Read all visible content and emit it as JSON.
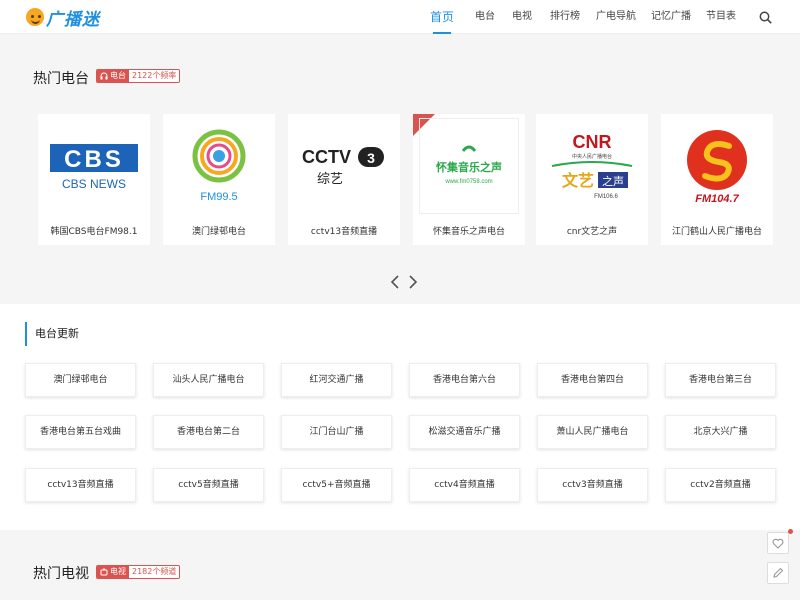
{
  "header": {
    "logo_text": "广播迷",
    "nav": [
      "首页",
      "电台",
      "电视",
      "排行榜",
      "广电导航",
      "记忆广播",
      "节目表"
    ],
    "active_nav": "首页"
  },
  "hot_radio": {
    "title": "热门电台",
    "tag_label": "电台",
    "tag_count": "2122个频率",
    "cards": [
      {
        "label": "韩国CBS电台FM98.1",
        "logo": "CBS NEWS"
      },
      {
        "label": "澳门绿邨电台",
        "logo": "FM99.5"
      },
      {
        "label": "cctv13音频直播",
        "logo": "CCTV 3 综艺"
      },
      {
        "label": "怀集音乐之声电台",
        "logo": "怀集音乐之声"
      },
      {
        "label": "cnr文艺之声",
        "logo": "CNR 文艺之声 FM106.6"
      },
      {
        "label": "江门鹤山人民广播电台",
        "logo": "FM104.7"
      }
    ]
  },
  "updates": {
    "title": "电台更新",
    "items": [
      "澳门绿邨电台",
      "汕头人民广播电台",
      "红河交通广播",
      "香港电台第六台",
      "香港电台第四台",
      "香港电台第三台",
      "香港电台第五台戏曲",
      "香港电台第二台",
      "江门台山广播",
      "松滋交通音乐广播",
      "萧山人民广播电台",
      "北京大兴广播",
      "cctv13音频直播",
      "cctv5音频直播",
      "cctv5+音频直播",
      "cctv4音频直播",
      "cctv3音频直播",
      "cctv2音频直播"
    ]
  },
  "hot_tv": {
    "title": "热门电视",
    "tag_label": "电视",
    "tag_count": "2182个频道"
  },
  "colors": {
    "accent": "#1f8fe0",
    "tag_red": "#d9534f",
    "logo_orange": "#f7a823"
  }
}
